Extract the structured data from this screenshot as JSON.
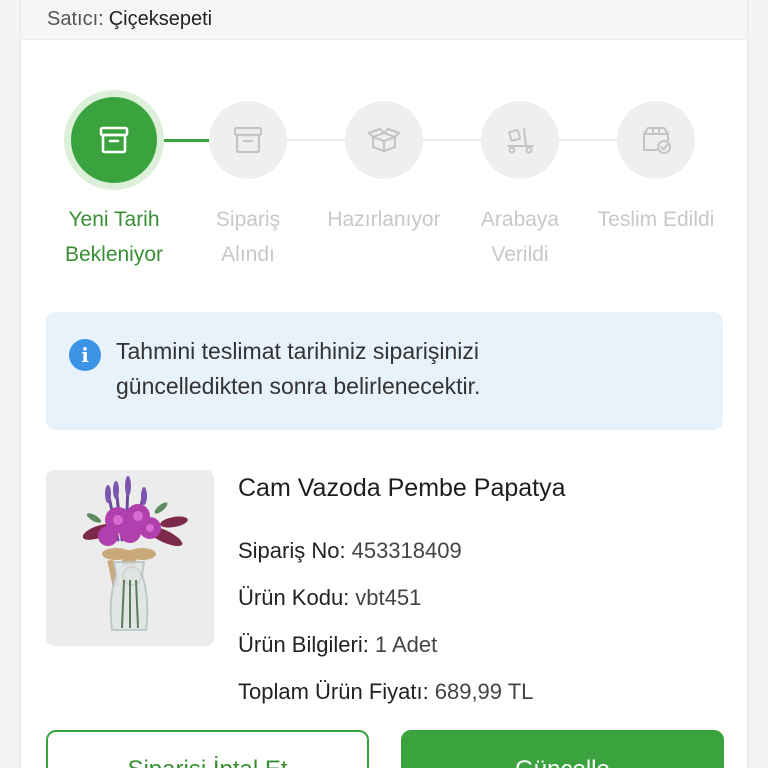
{
  "seller": {
    "label": "Satıcı:",
    "name": "Çiçeksepeti"
  },
  "steps": [
    {
      "label_line1": "Yeni Tarih",
      "label_line2": "Bekleniyor",
      "icon": "box-archive-icon",
      "state": "active"
    },
    {
      "label_line1": "Sipariş",
      "label_line2": "Alındı",
      "icon": "box-icon",
      "state": "pending"
    },
    {
      "label_line1": "Hazırlanıyor",
      "label_line2": "",
      "icon": "open-package-icon",
      "state": "pending"
    },
    {
      "label_line1": "Arabaya",
      "label_line2": "Verildi",
      "icon": "delivery-cart-icon",
      "state": "pending"
    },
    {
      "label_line1": "Teslim Edildi",
      "label_line2": "",
      "icon": "package-check-icon",
      "state": "pending"
    }
  ],
  "info": {
    "icon": "info-icon",
    "line1": "Tahmini teslimat tarihiniz siparişinizi",
    "line2": "güncelledikten sonra belirlenecektir."
  },
  "product": {
    "title": "Cam Vazoda Pembe Papatya",
    "details": [
      {
        "key": "Sipariş No:",
        "value": "453318409"
      },
      {
        "key": "Ürün Kodu:",
        "value": "vbt451"
      },
      {
        "key": "Ürün Bilgileri:",
        "value": "1 Adet"
      },
      {
        "key": "Toplam Ürün Fiyatı:",
        "value": "689,99 TL"
      }
    ]
  },
  "buttons": {
    "cancel_label": "Siparişi İptal Et",
    "update_label": "Güncelle"
  },
  "colors": {
    "accent": "#3aa33e",
    "info_bg": "#e8f2fb",
    "info_icon": "#3b93e6",
    "inactive": "#c8c8c8"
  }
}
